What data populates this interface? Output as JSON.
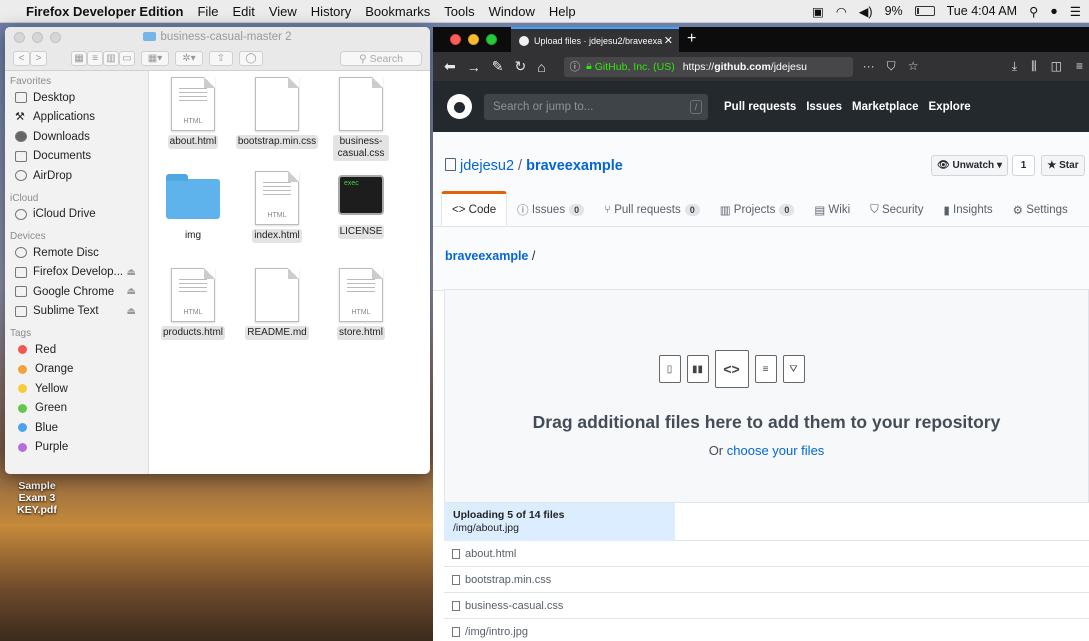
{
  "menubar": {
    "app": "Firefox Developer Edition",
    "items": [
      "File",
      "Edit",
      "View",
      "History",
      "Bookmarks",
      "Tools",
      "Window",
      "Help"
    ],
    "battery": "9%",
    "clock": "Tue 4:04 AM"
  },
  "desktop": {
    "file_line1": "Sample Exam 3",
    "file_line2": "KEY.pdf"
  },
  "finder": {
    "title": "business-casual-master 2",
    "search_placeholder": "Search",
    "sidebar": {
      "favorites_label": "Favorites",
      "favorites": [
        "Desktop",
        "Applications",
        "Downloads",
        "Documents",
        "AirDrop"
      ],
      "icloud_label": "iCloud",
      "icloud": [
        "iCloud Drive"
      ],
      "devices_label": "Devices",
      "devices": [
        "Remote Disc",
        "Firefox Develop...",
        "Google Chrome",
        "Sublime Text"
      ],
      "tags_label": "Tags",
      "tags": [
        {
          "name": "Red",
          "color": "#f0584f"
        },
        {
          "name": "Orange",
          "color": "#f4a23b"
        },
        {
          "name": "Yellow",
          "color": "#f5cc3a"
        },
        {
          "name": "Green",
          "color": "#5fc94b"
        },
        {
          "name": "Blue",
          "color": "#4aa3ee"
        },
        {
          "name": "Purple",
          "color": "#b56fd6"
        }
      ]
    },
    "files": [
      {
        "name": "about.html",
        "kind": "html",
        "tag": "HTML"
      },
      {
        "name": "bootstrap.min.css",
        "kind": "doc",
        "tag": ""
      },
      {
        "name": "business-casual.css",
        "kind": "doc",
        "tag": ""
      },
      {
        "name": "img",
        "kind": "folder",
        "tag": ""
      },
      {
        "name": "index.html",
        "kind": "html",
        "tag": "HTML"
      },
      {
        "name": "LICENSE",
        "kind": "exec",
        "tag": "exec"
      },
      {
        "name": "products.html",
        "kind": "html",
        "tag": "HTML"
      },
      {
        "name": "README.md",
        "kind": "doc",
        "tag": ""
      },
      {
        "name": "store.html",
        "kind": "html",
        "tag": "HTML"
      }
    ]
  },
  "firefox": {
    "tab_title": "Upload files · jdejesu2/braveexa",
    "identity": "GitHub, Inc. (US)",
    "url_prefix": "https://",
    "url_host": "github.com",
    "url_path": "/jdejesu"
  },
  "github": {
    "search_placeholder": "Search or jump to...",
    "search_key": "/",
    "nav": [
      "Pull requests",
      "Issues",
      "Marketplace",
      "Explore"
    ],
    "owner": "jdejesu2",
    "separator": " / ",
    "repo": "braveexample",
    "unwatch": "Unwatch ▾",
    "watch_count": "1",
    "star": "Star",
    "tabs": [
      {
        "label": "Code",
        "count": ""
      },
      {
        "label": "Issues",
        "count": "0"
      },
      {
        "label": "Pull requests",
        "count": "0"
      },
      {
        "label": "Projects",
        "count": "0"
      },
      {
        "label": "Wiki",
        "count": ""
      },
      {
        "label": "Security",
        "count": ""
      },
      {
        "label": "Insights",
        "count": ""
      },
      {
        "label": "Settings",
        "count": ""
      }
    ],
    "breadcrumb_repo": "braveexample",
    "breadcrumb_sep": " /",
    "drop_title": "Drag additional files here to add them to your repository",
    "drop_or": "Or ",
    "drop_link": "choose your files",
    "upload_status": "Uploading 5 of 14 files",
    "upload_current": "/img/about.jpg",
    "uploaded_files": [
      "about.html",
      "bootstrap.min.css",
      "business-casual.css",
      "/img/intro.jpg"
    ]
  }
}
